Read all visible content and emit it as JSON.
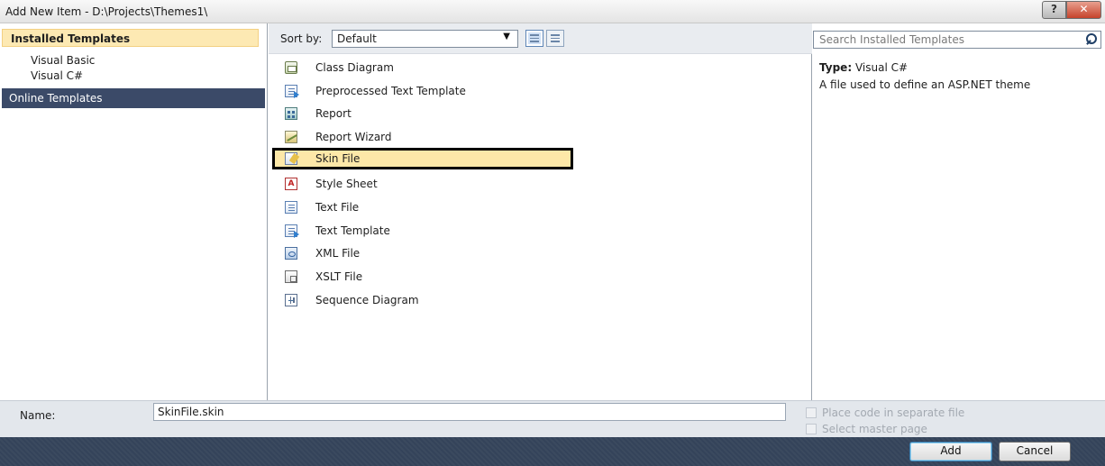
{
  "window": {
    "title": "Add New Item - D:\\Projects\\Themes1\\",
    "help_label": "?",
    "close_label": "✕"
  },
  "left_panel": {
    "installed_header": "Installed Templates",
    "tree_items": [
      "Visual Basic",
      "Visual C#"
    ],
    "online_header": "Online Templates"
  },
  "toolbar": {
    "sort_label": "Sort by:",
    "sort_value": "Default"
  },
  "templates": [
    {
      "label": "Class Diagram",
      "icon": "class-diagram-icon"
    },
    {
      "label": "Preprocessed Text Template",
      "icon": "preprocessed-text-template-icon"
    },
    {
      "label": "Report",
      "icon": "report-icon"
    },
    {
      "label": "Report Wizard",
      "icon": "report-wizard-icon"
    },
    {
      "label": "Skin File",
      "icon": "skin-file-icon",
      "selected": true
    },
    {
      "label": "Style Sheet",
      "icon": "style-sheet-icon"
    },
    {
      "label": "Text File",
      "icon": "text-file-icon"
    },
    {
      "label": "Text Template",
      "icon": "text-template-icon"
    },
    {
      "label": "XML File",
      "icon": "xml-file-icon"
    },
    {
      "label": "XSLT File",
      "icon": "xslt-file-icon"
    },
    {
      "label": "Sequence Diagram",
      "icon": "sequence-diagram-icon"
    }
  ],
  "right_panel": {
    "search_placeholder": "Search Installed Templates",
    "type_label": "Type:",
    "type_value": "Visual C#",
    "description": "A file used to define an ASP.NET theme"
  },
  "bottom": {
    "name_label": "Name:",
    "name_value": "SkinFile.skin",
    "place_code_label": "Place code in separate file",
    "select_master_label": "Select master page"
  },
  "buttons": {
    "add_label": "Add",
    "cancel_label": "Cancel"
  },
  "colors": {
    "selection_bg": "#fde8a8",
    "selection_border": "#000000",
    "online_header_bg": "#3b4a68",
    "installed_header_bg": "#fde9b3"
  }
}
